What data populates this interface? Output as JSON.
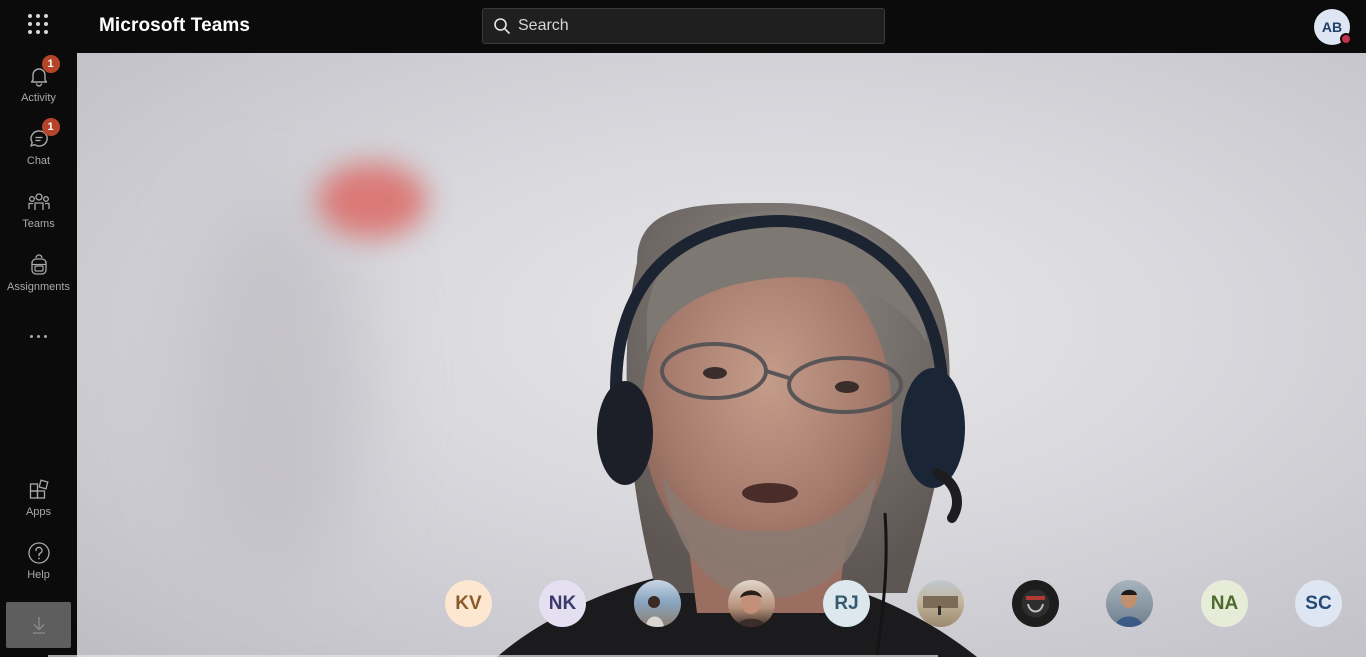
{
  "app": {
    "title": "Microsoft Teams"
  },
  "search": {
    "placeholder": "Search"
  },
  "user": {
    "initials": "AB",
    "presence_color": "#c4314b"
  },
  "rail": {
    "items": [
      {
        "label": "Activity",
        "icon": "bell-icon",
        "badge": "1"
      },
      {
        "label": "Chat",
        "icon": "chat-icon",
        "badge": "1"
      },
      {
        "label": "Teams",
        "icon": "teams-icon"
      },
      {
        "label": "Assignments",
        "icon": "backpack-icon"
      }
    ],
    "bottom_items": [
      {
        "label": "Apps",
        "icon": "apps-icon"
      },
      {
        "label": "Help",
        "icon": "help-icon"
      }
    ],
    "more_icon": "more-icon",
    "download_icon": "download-icon"
  },
  "participants": [
    {
      "initials": "KV",
      "bg": "#fde7d0",
      "fg": "#8a5a2b"
    },
    {
      "initials": "NK",
      "bg": "#e4e0f2",
      "fg": "#3b3a6b"
    },
    {
      "initials": "",
      "photo": true,
      "bg": "#8aa6c2"
    },
    {
      "initials": "",
      "photo": true,
      "bg": "#6b5a4d"
    },
    {
      "initials": "RJ",
      "bg": "#dce8ee",
      "fg": "#355a6e"
    },
    {
      "initials": "",
      "photo": true,
      "bg": "#9a8a6d"
    },
    {
      "initials": "",
      "photo": true,
      "bg": "#1d1d1d"
    },
    {
      "initials": "",
      "photo": true,
      "bg": "#6f7f8c"
    },
    {
      "initials": "NA",
      "bg": "#e6ecd8",
      "fg": "#4d6b2e"
    },
    {
      "initials": "SC",
      "bg": "#dde6f2",
      "fg": "#274a78"
    }
  ],
  "colors": {
    "background": "#0b0b0b",
    "badge": "#b5442a"
  }
}
